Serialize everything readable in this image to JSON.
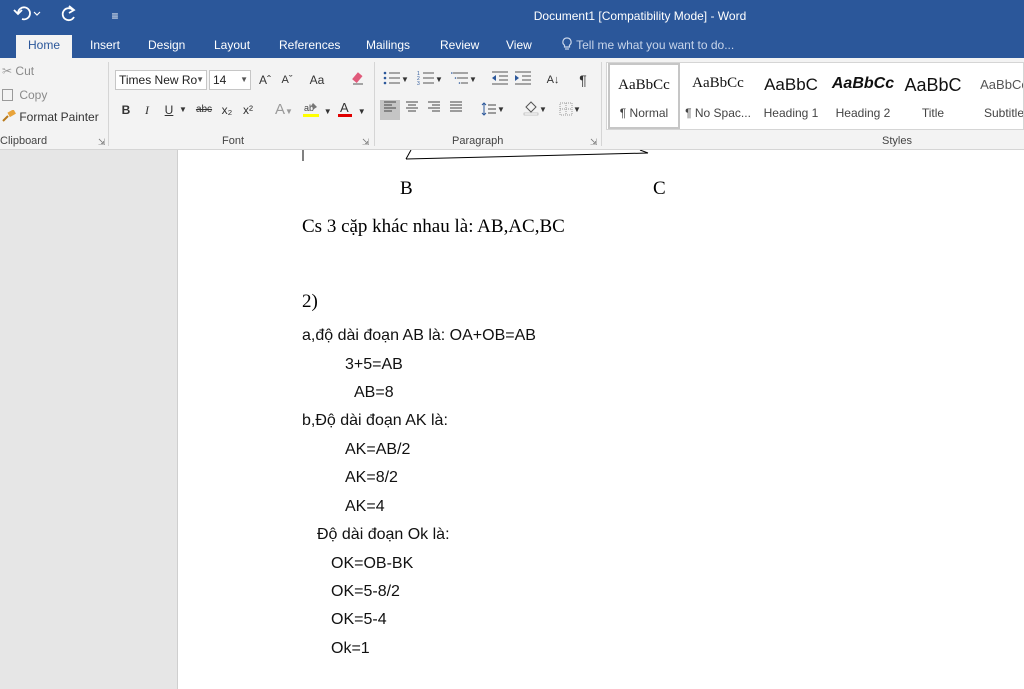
{
  "window": {
    "title": "Document1 [Compatibility Mode] - Word"
  },
  "qat": {
    "customize": "≡"
  },
  "tabs": [
    "Home",
    "Insert",
    "Design",
    "Layout",
    "References",
    "Mailings",
    "Review",
    "View"
  ],
  "tell_me": "Tell me what you want to do...",
  "clipboard": {
    "cut": "Cut",
    "copy": "Copy",
    "format_painter": "Format Painter",
    "label": "Clipboard"
  },
  "font": {
    "name": "Times New Ro",
    "size": "14",
    "grow": "Aˆ",
    "shrink": "Aˇ",
    "change_case": "Aa",
    "bold": "B",
    "italic": "I",
    "underline": "U",
    "strike": "abc",
    "subscript": "x₂",
    "superscript": "x²",
    "label": "Font",
    "highlight_color": "#ffff00",
    "font_color": "#e00000"
  },
  "paragraph": {
    "label": "Paragraph",
    "pilcrow": "¶",
    "sort": "A↓"
  },
  "styles": {
    "label": "Styles",
    "items": [
      {
        "preview": "AaBbCc",
        "name": "¶ Normal"
      },
      {
        "preview": "AaBbCc",
        "name": "¶ No Spac..."
      },
      {
        "preview": "AaBbC",
        "name": "Heading 1"
      },
      {
        "preview": "AaBbCc",
        "name": "Heading 2"
      },
      {
        "preview": "AaBbC",
        "name": "Title"
      },
      {
        "preview": "AaBbCc",
        "name": "Subtitle"
      }
    ]
  },
  "document": {
    "label_b": "B",
    "label_c": "C",
    "line1": "Cs 3 cặp khác nhau là: AB,AC,BC",
    "section": "2)",
    "lines": [
      "a,độ dài đoạn AB là: OA+OB=AB",
      "3+5=AB",
      "AB=8",
      "b,Độ dài đoạn AK là:",
      "AK=AB/2",
      "AK=8/2",
      "AK=4",
      "Độ dài đoạn Ok là:",
      "OK=OB-BK",
      "OK=5-8/2",
      "OK=5-4",
      "Ok=1"
    ]
  }
}
